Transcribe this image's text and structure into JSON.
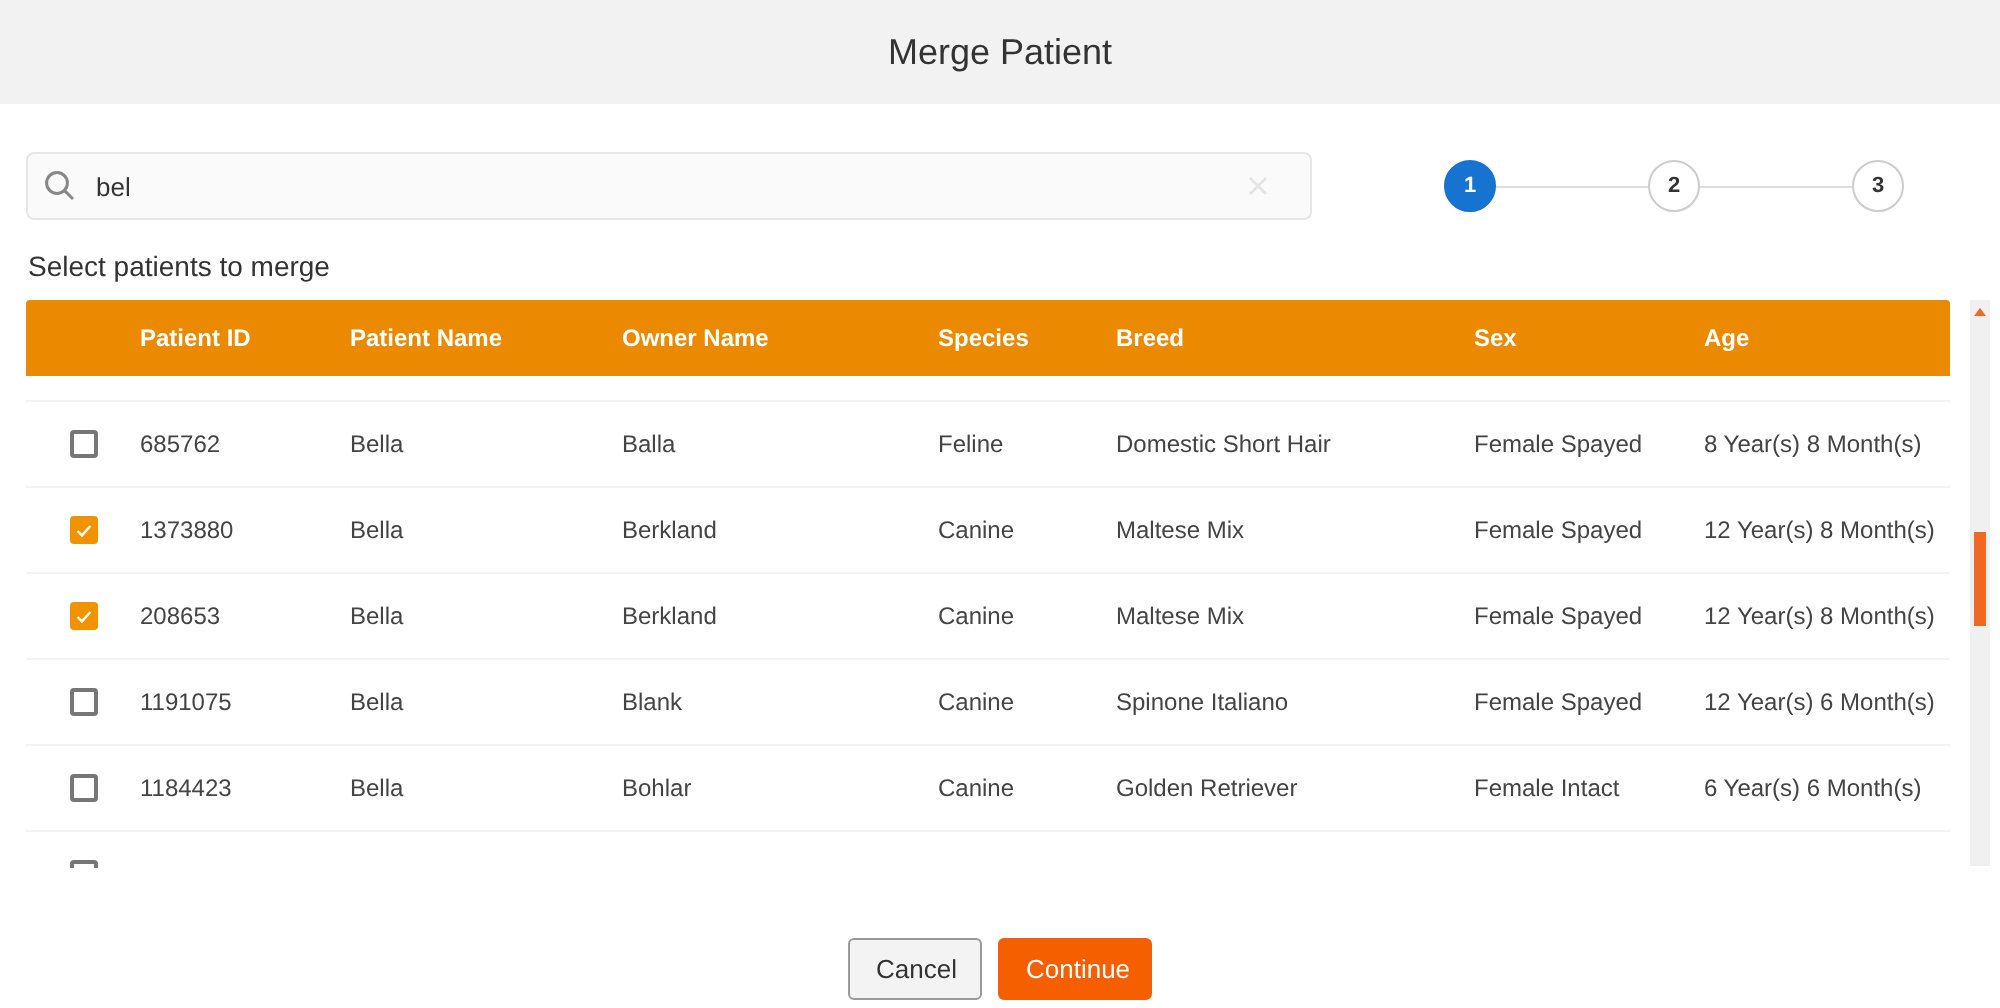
{
  "dialog": {
    "title": "Merge Patient"
  },
  "search": {
    "value": "bel"
  },
  "stepper": [
    {
      "label": "1",
      "selected": true
    },
    {
      "label": "2",
      "selected": false
    },
    {
      "label": "3",
      "selected": false
    }
  ],
  "section_label": "Select patients to merge",
  "table": {
    "columns": [
      "Patient ID",
      "Patient Name",
      "Owner Name",
      "Species",
      "Breed",
      "Sex",
      "Age"
    ],
    "rows": [
      {
        "checked": false,
        "cells": [
          "685762",
          "Bella",
          "Balla",
          "Feline",
          "Domestic Short Hair",
          "Female Spayed",
          "8 Year(s) 8 Month(s)"
        ]
      },
      {
        "checked": true,
        "cells": [
          "1373880",
          "Bella",
          "Berkland",
          "Canine",
          "Maltese Mix",
          "Female Spayed",
          "12 Year(s) 8 Month(s)"
        ]
      },
      {
        "checked": true,
        "cells": [
          "208653",
          "Bella",
          "Berkland",
          "Canine",
          "Maltese Mix",
          "Female Spayed",
          "12 Year(s) 8 Month(s)"
        ]
      },
      {
        "checked": false,
        "cells": [
          "1191075",
          "Bella",
          "Blank",
          "Canine",
          "Spinone Italiano",
          "Female Spayed",
          "12 Year(s) 6 Month(s)"
        ]
      },
      {
        "checked": false,
        "cells": [
          "1184423",
          "Bella",
          "Bohlar",
          "Canine",
          "Golden Retriever",
          "Female Intact",
          "6 Year(s) 6 Month(s)"
        ]
      },
      {
        "checked": false
      }
    ]
  },
  "buttons": [
    {
      "label": "Cancel",
      "kind": "secondary"
    },
    {
      "label": "Continue",
      "kind": "primary"
    }
  ]
}
